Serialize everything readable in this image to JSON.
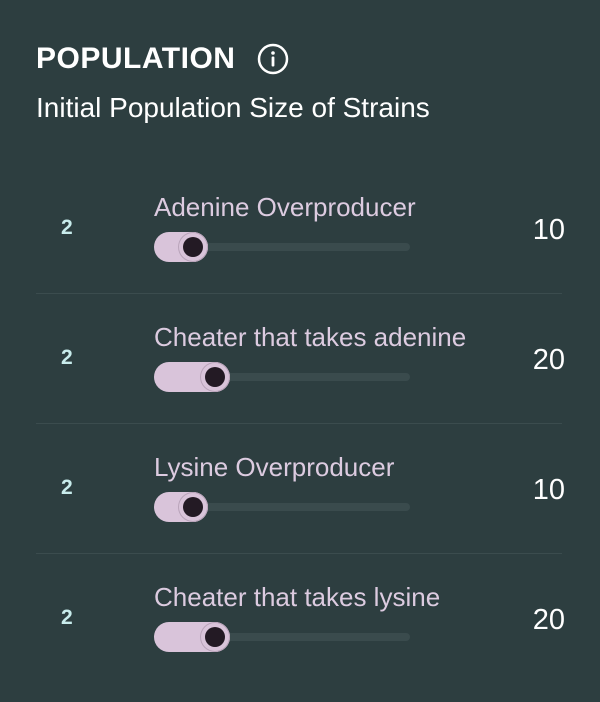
{
  "panel": {
    "title": "POPULATION",
    "subtitle": "Initial Population Size of Strains",
    "info_icon": "info-circle-icon"
  },
  "strains": [
    {
      "label": "Adenine Overproducer",
      "min": "2",
      "value": "10",
      "slider_fraction": 0.08
    },
    {
      "label": "Cheater that takes adenine",
      "min": "2",
      "value": "20",
      "slider_fraction": 0.18
    },
    {
      "label": "Lysine Overproducer",
      "min": "2",
      "value": "10",
      "slider_fraction": 0.08
    },
    {
      "label": "Cheater that takes lysine",
      "min": "2",
      "value": "20",
      "slider_fraction": 0.18
    }
  ],
  "colors": {
    "background": "#2d3e40",
    "accent": "#d9c4da",
    "thumb_center": "#231a24",
    "min_label": "#c8ecec"
  }
}
